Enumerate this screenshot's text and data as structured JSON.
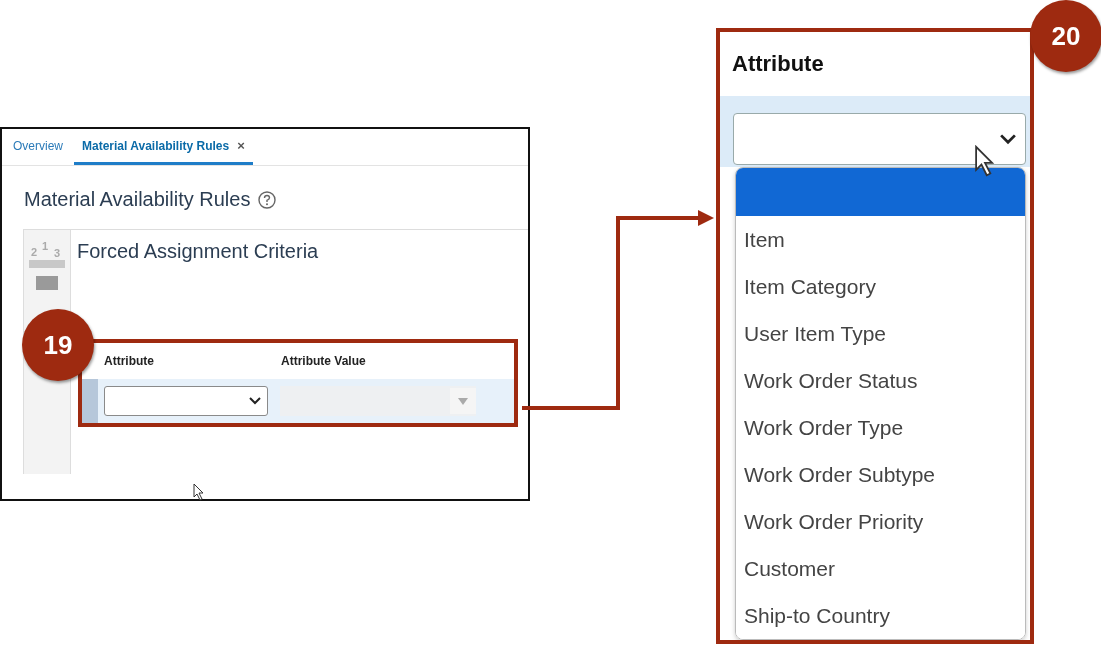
{
  "left_screen": {
    "tabs": [
      {
        "label": "Overview",
        "selected": false,
        "closable": false
      },
      {
        "label": "Material Availability Rules",
        "selected": true,
        "closable": true,
        "close_glyph": "×"
      }
    ],
    "page_title": "Material Availability Rules",
    "ranking_icon_digits": [
      "2",
      "1",
      "3"
    ],
    "section_title": "Forced Assignment Criteria",
    "table": {
      "columns": [
        "Attribute",
        "Attribute Value"
      ]
    }
  },
  "right_screen": {
    "column": "Attribute",
    "options": [
      {
        "selected": true
      },
      {
        "label": "Item",
        "selected": false
      },
      {
        "label": "Item Category",
        "selected": false
      },
      {
        "label": "User Item Type",
        "selected": false
      },
      {
        "label": "Work Order Status",
        "selected": false
      },
      {
        "label": "Work Order Type",
        "selected": false
      },
      {
        "label": "Work Order Subtype",
        "selected": false
      },
      {
        "label": "Work Order Priority",
        "selected": false
      },
      {
        "label": "Customer",
        "selected": false
      },
      {
        "label": "Ship-to Country",
        "selected": false
      }
    ]
  },
  "callouts": [
    {
      "number": "19"
    },
    {
      "number": "20"
    }
  ]
}
